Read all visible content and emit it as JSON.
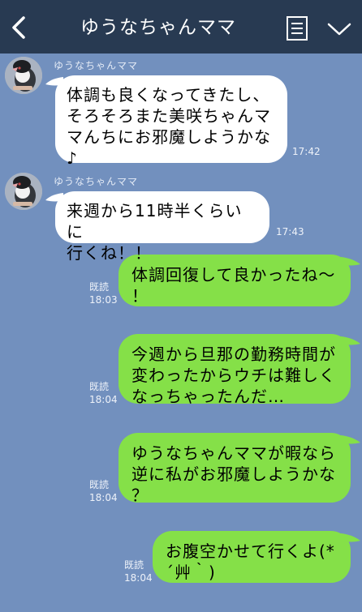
{
  "header": {
    "title": "ゆうなちゃんママ",
    "back_icon": "chevron-left-icon",
    "menu_icon": "notes-icon",
    "dropdown_icon": "chevron-down-icon"
  },
  "messages": [
    {
      "sender": "ゆうなちゃんママ",
      "text": "体調も良くなってきたし、\nそろそろまた美咲ちゃんマ\nマんちにお邪魔しようかな\n♪",
      "time": "17:42"
    },
    {
      "sender": "ゆうなちゃんママ",
      "text": "来週から11時半くらいに\n行くね！！",
      "time": "17:43"
    },
    {
      "text": "体調回復して良かったね〜\n！",
      "read": "既読",
      "time": "18:03"
    },
    {
      "text": "今週から旦那の勤務時間が\n変わったからウチは難しく\nなっちゃったんだ…",
      "read": "既読",
      "time": "18:04"
    },
    {
      "text": "ゆうなちゃんママが暇なら\n逆に私がお邪魔しようかな\n？",
      "read": "既読",
      "time": "18:04"
    },
    {
      "text": "お腹空かせて行くよ(*\n´艸｀)",
      "read": "既読",
      "time": "18:04"
    }
  ],
  "colors": {
    "background": "#7290be",
    "header": "#283a52",
    "incoming_bubble": "#ffffff",
    "outgoing_bubble": "#85e048"
  }
}
